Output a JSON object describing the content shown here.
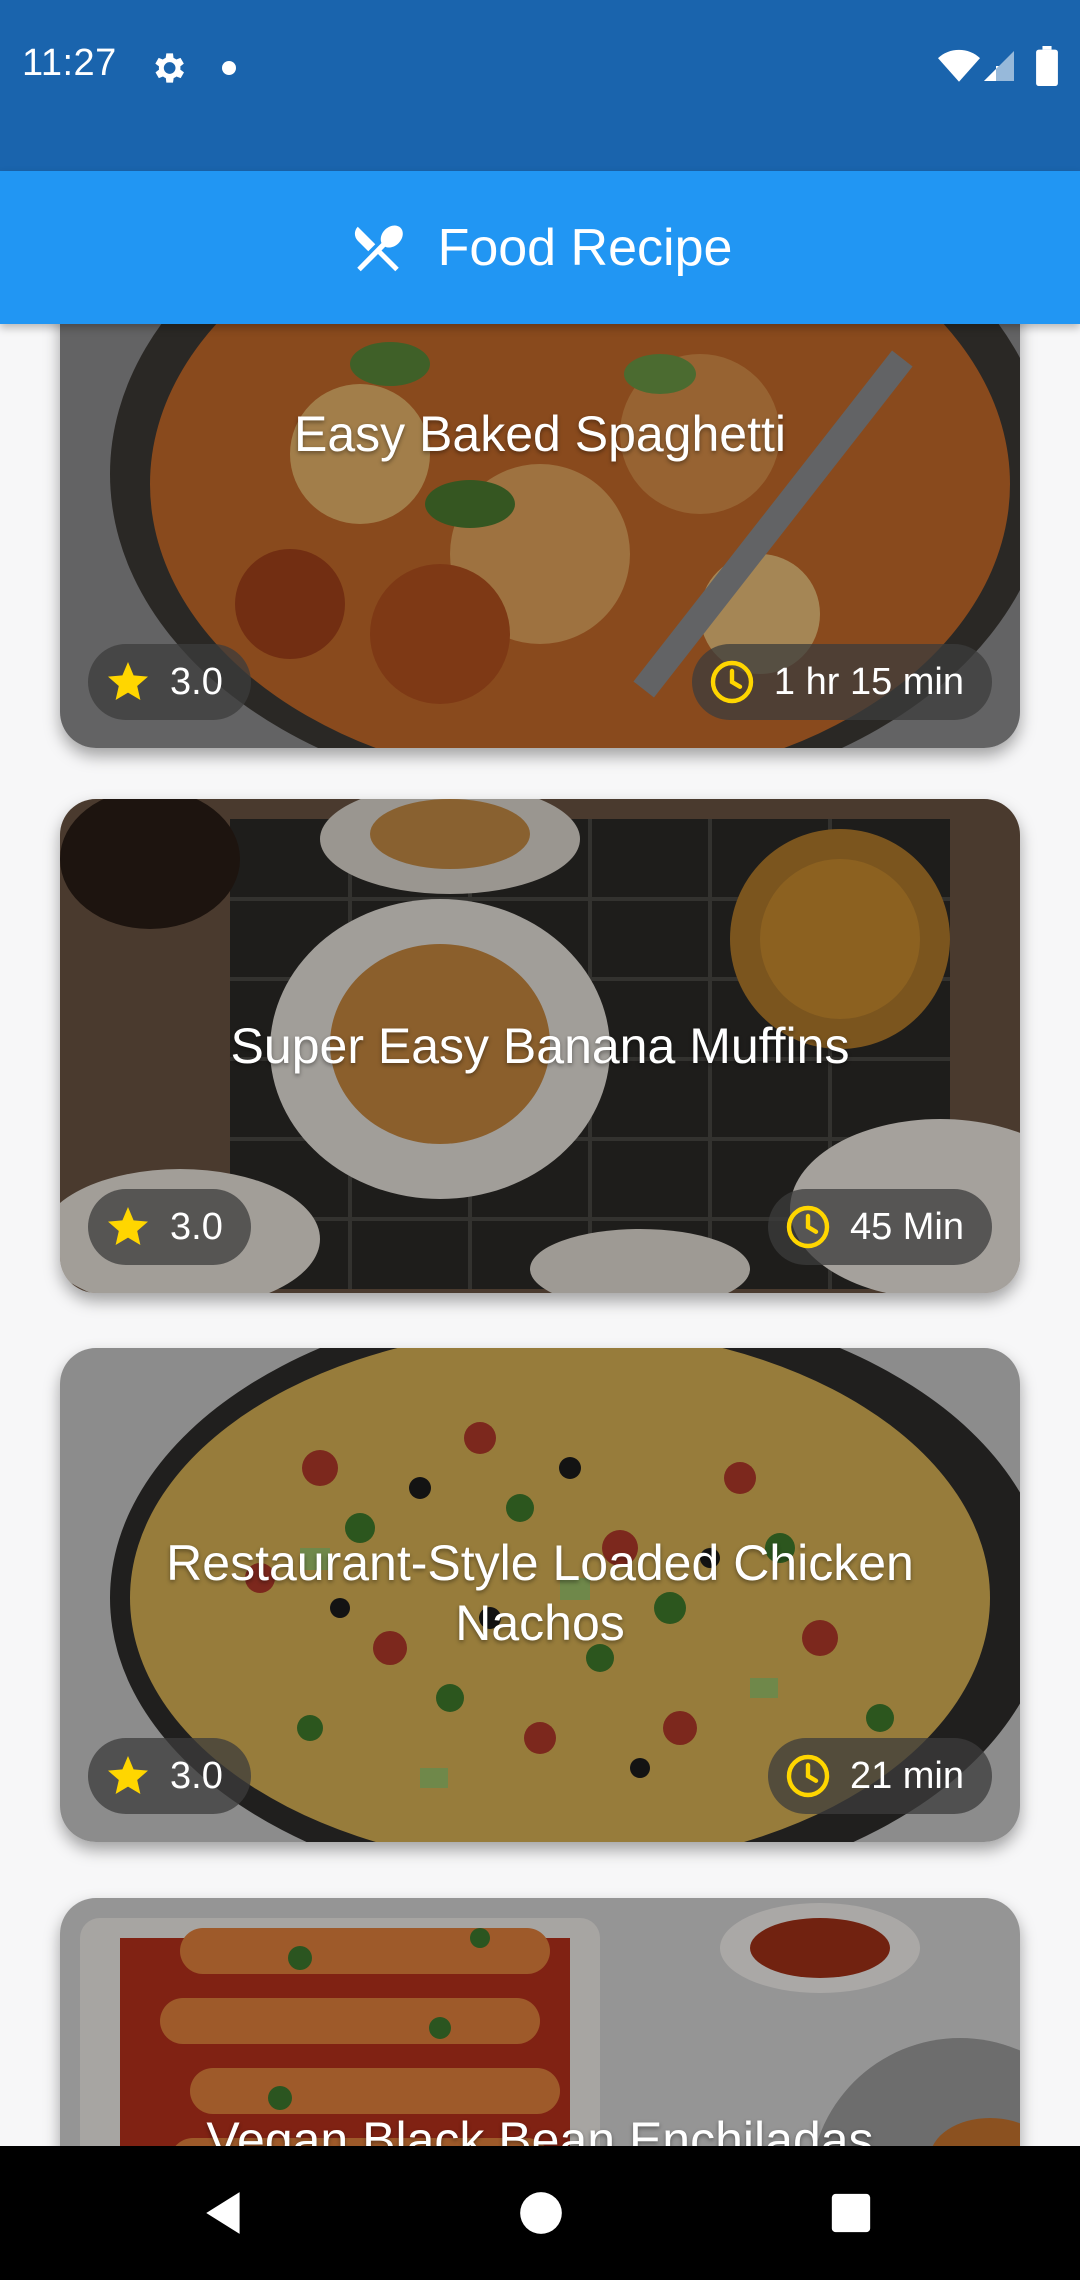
{
  "status_bar": {
    "time": "11:27",
    "icons": [
      "gear-icon",
      "notification-dot",
      "wifi-icon",
      "signal-icon",
      "battery-icon"
    ],
    "background": "#1a64ad"
  },
  "app_bar": {
    "title": "Food Recipe",
    "icon": "fork-knife-icon",
    "background": "#2196f3"
  },
  "recipes": [
    {
      "title": "Easy Baked Spaghetti",
      "rating": "3.0",
      "time": "1 hr 15 min"
    },
    {
      "title": "Super Easy Banana Muffins",
      "rating": "3.0",
      "time": "45 Min"
    },
    {
      "title": "Restaurant-Style Loaded Chicken Nachos",
      "rating": "3.0",
      "time": "21 min"
    },
    {
      "title": "Vegan Black Bean Enchiladas",
      "rating": "",
      "time": ""
    }
  ],
  "colors": {
    "star": "#ffd600",
    "clock": "#ffd600"
  },
  "nav_bar": {
    "icons": [
      "back-icon",
      "home-icon",
      "recents-icon"
    ]
  }
}
